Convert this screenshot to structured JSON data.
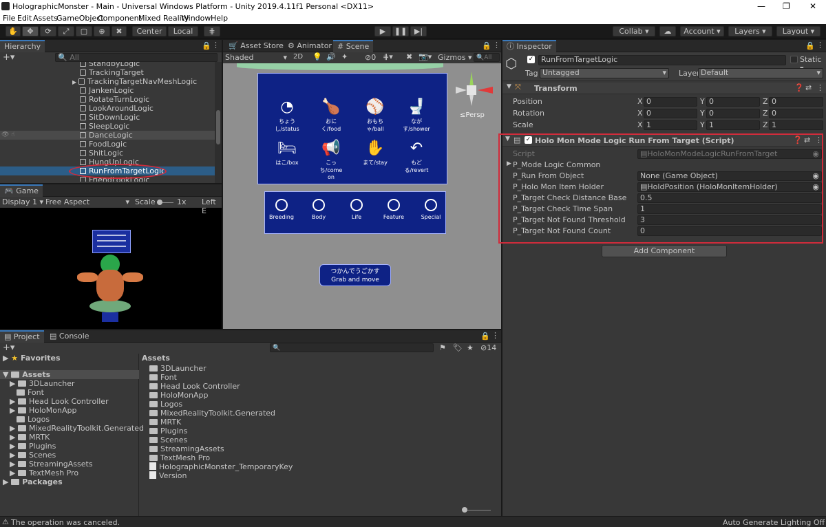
{
  "window": {
    "title": "HolographicMonster - Main - Universal Windows Platform - Unity 2019.4.11f1 Personal <DX11>"
  },
  "menu": [
    "File",
    "Edit",
    "Assets",
    "GameObject",
    "Component",
    "Mixed Reality",
    "Window",
    "Help"
  ],
  "toolbar": {
    "center": "Center",
    "local": "Local",
    "collab": "Collab",
    "account": "Account",
    "layers": "Layers",
    "layout": "Layout"
  },
  "hierarchy": {
    "tab": "Hierarchy",
    "search_placeholder": "All",
    "items": [
      "StandbyLogic",
      "TrackingTarget",
      "TrackingTargetNavMeshLogic",
      "JankenLogic",
      "RotateTurnLogic",
      "LookAroundLogic",
      "SitDownLogic",
      "SleepLogic",
      "DanceLogic",
      "FoodLogic",
      "ShitLogic",
      "HungUpLogic",
      "RunFromTargetLogic",
      "FriendLookLogic"
    ]
  },
  "game": {
    "tab": "Game",
    "display": "Display 1",
    "aspect": "Free Aspect",
    "scale_label": "Scale",
    "scale_value": "1x",
    "left": "Left E"
  },
  "scene": {
    "tabs": [
      "Asset Store",
      "Animator",
      "Scene"
    ],
    "shading": "Shaded",
    "mode2d": "2D",
    "gizmos": "Gizmos",
    "search": "All",
    "hidden_count": "0",
    "persp": "Persp",
    "menu_buttons": [
      {
        "label": "ちょうし/status",
        "icon": "gauge-icon",
        "glyph": "◔"
      },
      {
        "label": "おにく/food",
        "icon": "meat-icon",
        "glyph": "🍗"
      },
      {
        "label": "おもちゃ/ball",
        "icon": "ball-icon",
        "glyph": "⚾"
      },
      {
        "label": "ながす/shower",
        "icon": "toilet-icon",
        "glyph": "🚽"
      },
      {
        "label": "はこ/box",
        "icon": "bed-icon",
        "glyph": "🛏"
      },
      {
        "label": "こっち/come on",
        "icon": "megaphone-icon",
        "glyph": "📢"
      },
      {
        "label": "まて/stay",
        "icon": "hand-icon",
        "glyph": "✋"
      },
      {
        "label": "もどる/revert",
        "icon": "revert-icon",
        "glyph": "↶"
      }
    ],
    "category_buttons": [
      "Breeding",
      "Body",
      "Life",
      "Feature",
      "Special"
    ],
    "grab_line1": "つかんでうごかす",
    "grab_line2": "Grab and move"
  },
  "project": {
    "tabs": [
      "Project",
      "Console"
    ],
    "hidden_count": "14",
    "favorites": "Favorites",
    "assets_label": "Assets",
    "packages": "Packages",
    "tree": [
      "3DLauncher",
      "Font",
      "Head Look Controller",
      "HoloMonApp",
      "Logos",
      "MixedRealityToolkit.Generated",
      "MRTK",
      "Plugins",
      "Scenes",
      "StreamingAssets",
      "TextMesh Pro"
    ],
    "assets_header": "Assets",
    "assets_items": [
      "3DLauncher",
      "Font",
      "Head Look Controller",
      "HoloMonApp",
      "Logos",
      "MixedRealityToolkit.Generated",
      "MRTK",
      "Plugins",
      "Scenes",
      "StreamingAssets",
      "TextMesh Pro",
      "HolographicMonster_TemporaryKey",
      "Version"
    ]
  },
  "inspector": {
    "tab": "Inspector",
    "object_name": "RunFromTargetLogic",
    "static_label": "Static",
    "tag_label": "Tag",
    "tag_value": "Untagged",
    "layer_label": "Layer",
    "layer_value": "Default",
    "transform": {
      "title": "Transform",
      "rows": [
        {
          "label": "Position",
          "x": "0",
          "y": "0",
          "z": "0"
        },
        {
          "label": "Rotation",
          "x": "0",
          "y": "0",
          "z": "0"
        },
        {
          "label": "Scale",
          "x": "1",
          "y": "1",
          "z": "1"
        }
      ]
    },
    "script_component": {
      "title": "Holo Mon Mode Logic Run From Target (Script)",
      "script_label": "Script",
      "script_value": "HoloMonModeLogicRunFromTarget",
      "mode_common": "P_Mode Logic Common",
      "rows": [
        {
          "label": "P_Run From Object",
          "value": "None (Game Object)"
        },
        {
          "label": "P_Holo Mon Item Holder",
          "value": "HoldPosition (HoloMonItemHolder)"
        },
        {
          "label": "P_Target Check Distance Base",
          "value": "0.5"
        },
        {
          "label": "P_Target Check Time Span",
          "value": "1"
        },
        {
          "label": "P_Target Not Found Threshold",
          "value": "3"
        },
        {
          "label": "P_Target Not Found Count",
          "value": "0"
        }
      ]
    },
    "add_component": "Add Component"
  },
  "status": {
    "message": "The operation was canceled.",
    "right": "Auto Generate Lighting Off"
  },
  "colors": {
    "accent": "#3a79bb",
    "highlight": "#d12c3b",
    "selection": "#2c5d87",
    "ui_panel": "#0e2285"
  }
}
